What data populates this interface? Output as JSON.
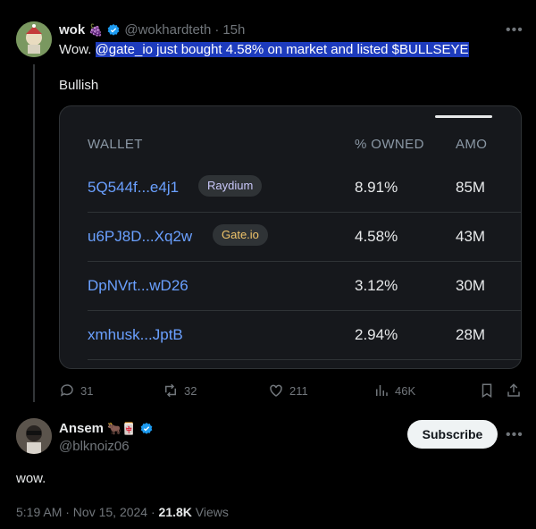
{
  "reply_tweet": {
    "author_name": "wok",
    "author_emoji": "🍇",
    "handle": "@wokhardteth",
    "time": "15h",
    "text_highlighted": "@gate_io just bought 4.58% on market and listed $BULLSEYE",
    "text_prefix": "Wow.",
    "text_line2": "Bullish",
    "stats": {
      "replies": "31",
      "reposts": "32",
      "likes": "211",
      "views": "46K"
    }
  },
  "card": {
    "headers": {
      "wallet": "WALLET",
      "owned": "% OWNED",
      "amount": "AMO"
    },
    "rows": [
      {
        "wallet": "5Q544f...e4j1",
        "tag": "Raydium",
        "owned": "8.91%",
        "amount": "85M"
      },
      {
        "wallet": "u6PJ8D...Xq2w",
        "tag": "Gate.io",
        "owned": "4.58%",
        "amount": "43M"
      },
      {
        "wallet": "DpNVrt...wD26",
        "tag": "",
        "owned": "3.12%",
        "amount": "30M"
      },
      {
        "wallet": "xmhusk...JptB",
        "tag": "",
        "owned": "2.94%",
        "amount": "28M"
      }
    ]
  },
  "main_tweet": {
    "author_name": "Ansem",
    "author_emoji": "🐂🀄",
    "handle": "@blknoiz06",
    "subscribe_label": "Subscribe",
    "text": "wow.",
    "timestamp": "5:19 AM · Nov 15, 2024",
    "views_count": "21.8K",
    "views_label": "Views"
  },
  "colors": {
    "background": "#000000",
    "link": "#6aa0ff",
    "verified": "#1d9bf0",
    "highlight": "#1d3bbd"
  }
}
